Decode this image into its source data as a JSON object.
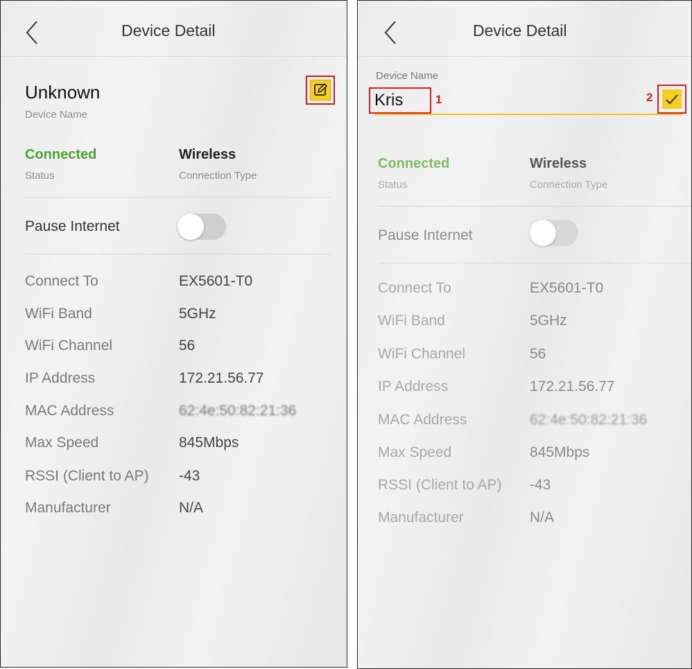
{
  "screens": [
    {
      "header_title": "Device Detail",
      "device_name": "Unknown",
      "device_name_label": "Device Name",
      "status_value": "Connected",
      "status_label": "Status",
      "connection_value": "Wireless",
      "connection_label": "Connection Type",
      "pause_label": "Pause Internet",
      "rows": [
        {
          "label": "Connect To",
          "value": "EX5601-T0"
        },
        {
          "label": "WiFi Band",
          "value": "5GHz"
        },
        {
          "label": "WiFi Channel",
          "value": "56"
        },
        {
          "label": "IP Address",
          "value": "172.21.56.77"
        },
        {
          "label": "MAC Address",
          "value": "62:4e:50:82:21:36"
        },
        {
          "label": "Max Speed",
          "value": "845Mbps"
        },
        {
          "label": "RSSI (Client to AP)",
          "value": "-43"
        },
        {
          "label": "Manufacturer",
          "value": "N/A"
        }
      ]
    },
    {
      "header_title": "Device Detail",
      "device_name_label": "Device Name",
      "device_name_input": "Kris",
      "marker_1": "1",
      "marker_2": "2",
      "status_value": "Connected",
      "status_label": "Status",
      "connection_value": "Wireless",
      "connection_label": "Connection Type",
      "pause_label": "Pause Internet",
      "rows": [
        {
          "label": "Connect To",
          "value": "EX5601-T0"
        },
        {
          "label": "WiFi Band",
          "value": "5GHz"
        },
        {
          "label": "WiFi Channel",
          "value": "56"
        },
        {
          "label": "IP Address",
          "value": "172.21.56.77"
        },
        {
          "label": "MAC Address",
          "value": "62:4e:50:82:21:36"
        },
        {
          "label": "Max Speed",
          "value": "845Mbps"
        },
        {
          "label": "RSSI (Client to AP)",
          "value": "-43"
        },
        {
          "label": "Manufacturer",
          "value": "N/A"
        }
      ]
    }
  ],
  "colors": {
    "accent_yellow": "#f6cf1f",
    "status_green": "#4aa52e",
    "annotation_red": "#e02020"
  },
  "icons": {
    "back": "chevron-left-icon",
    "edit": "edit-icon",
    "confirm": "check-icon"
  },
  "pause_internet_on": false
}
